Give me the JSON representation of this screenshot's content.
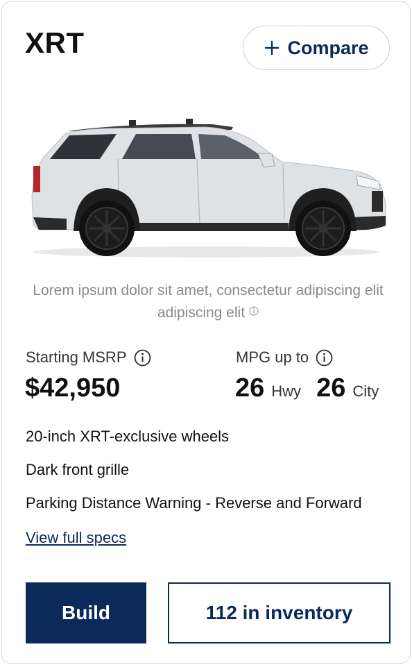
{
  "card": {
    "trim_name": "XRT",
    "compare_label": "Compare",
    "tagline": "Lorem ipsum dolor sit amet, consectetur adipiscing elit adipiscing elit",
    "msrp_label": "Starting MSRP",
    "msrp_value": "$42,950",
    "mpg_label": "MPG up to",
    "mpg_hwy_value": "26",
    "mpg_hwy_unit": "Hwy",
    "mpg_city_value": "26",
    "mpg_city_unit": "City",
    "features": [
      "20-inch XRT-exclusive wheels",
      "Dark front grille",
      "Parking Distance Warning - Reverse and Forward"
    ],
    "specs_link": "View full specs",
    "build_label": "Build",
    "inventory_label": "112 in inventory"
  },
  "icons": {
    "compare": "plus-icon",
    "info": "info-icon",
    "vehicle": "suv-image"
  },
  "colors": {
    "brand_navy": "#0b2a5b",
    "muted_text": "#8a8a8a",
    "car_body": "#dfe2e5"
  }
}
